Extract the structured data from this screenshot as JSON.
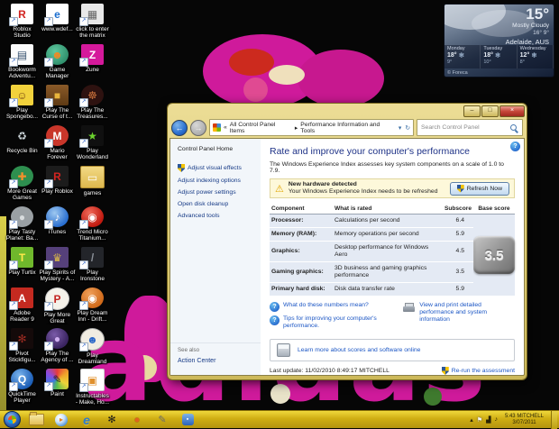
{
  "icons_map": {
    "back": "←",
    "forward": "→",
    "dropdown": "▾",
    "refresh": "↻",
    "shortcut": "↗",
    "warning": "⚠",
    "help": "?",
    "minimize": "–",
    "maximize": "□",
    "close": "×",
    "crumb_sep": "▸",
    "play": "▸",
    "ie": "e",
    "pivot": "✻",
    "game": "●",
    "tool": "✎",
    "msn": "▪",
    "tray_up": "▴",
    "tray_flag": "⚑",
    "tray_net": "▟",
    "tray_vol": "♪",
    "snow": "❄"
  },
  "colors": {
    "accent_gold": "#cfae13",
    "wallpaper_magenta": "#cf1a9b",
    "link_blue": "#1a55c4",
    "heading_blue": "#1e3287"
  },
  "desktop": {
    "wallpaper_word": "adidas",
    "icons": [
      {
        "label": "Roblox Studio",
        "glyph": "R"
      },
      {
        "label": "www.wdef...",
        "glyph": "e"
      },
      {
        "label": "click to enter the matrix",
        "glyph": "▦"
      },
      {
        "label": "Bookworm Adventu...",
        "glyph": "▤"
      },
      {
        "label": "Game Manager",
        "glyph": "☻"
      },
      {
        "label": "Zune",
        "glyph": "Z"
      },
      {
        "label": "Play Spongebo...",
        "glyph": "☺"
      },
      {
        "label": "Play The Curse of t...",
        "glyph": "■"
      },
      {
        "label": "Play The Treasures...",
        "glyph": "☸"
      },
      {
        "label": "Recycle Bin",
        "glyph": "♻"
      },
      {
        "label": "Mario Forever",
        "glyph": "M"
      },
      {
        "label": "Play Wonderland",
        "glyph": "★"
      },
      {
        "label": "More Great Games",
        "glyph": "✚"
      },
      {
        "label": "Play Roblox",
        "glyph": "R"
      },
      {
        "label": "games",
        "glyph": "▭"
      },
      {
        "label": "Play Tasty Planet: Ba...",
        "glyph": "●"
      },
      {
        "label": "iTunes",
        "glyph": "♪"
      },
      {
        "label": "Trend Micro Titanium...",
        "glyph": "◉"
      },
      {
        "label": "Play Turtix",
        "glyph": "T"
      },
      {
        "label": "Play Spirits of Mystery - A...",
        "glyph": "♛"
      },
      {
        "label": "Play Ironstone",
        "glyph": "/"
      },
      {
        "label": "Adobe Reader 9",
        "glyph": "A"
      },
      {
        "label": "Play More Great Games!",
        "glyph": "P"
      },
      {
        "label": "Play Dream Inn - Drift...",
        "glyph": "◉"
      },
      {
        "label": "Pivot Stickfigu...",
        "glyph": "✻"
      },
      {
        "label": "Play The Agency of ...",
        "glyph": "●"
      },
      {
        "label": "Play Dreamland",
        "glyph": "☻"
      },
      {
        "label": "QuickTime Player",
        "glyph": "Q"
      },
      {
        "label": "Paint",
        "glyph": "✎"
      },
      {
        "label": "Instructables - Make, Ho...",
        "glyph": "▣"
      }
    ]
  },
  "weather": {
    "temp": "15°",
    "condition": "Mostly Cloudy",
    "high": "16°",
    "low": "9°",
    "location": "Adelaide, AUS",
    "forecast": [
      {
        "day": "Monday",
        "hi": "18°",
        "lo": "9°"
      },
      {
        "day": "Tuesday",
        "hi": "18°",
        "lo": "10°"
      },
      {
        "day": "Wednesday",
        "hi": "12°",
        "lo": "8°"
      }
    ],
    "credit": "© Foreca"
  },
  "window": {
    "nav": {
      "crumb_prefix": "«",
      "crumb1": "All Control Panel Items",
      "crumb2": "Performance Information and Tools",
      "search_placeholder": "Search Control Panel"
    },
    "sidebar": {
      "home": "Control Panel Home",
      "items": [
        "Adjust visual effects",
        "Adjust indexing options",
        "Adjust power settings",
        "Open disk cleanup",
        "Advanced tools"
      ],
      "see_also": "See also",
      "action_center": "Action Center"
    },
    "main": {
      "title": "Rate and improve your computer's performance",
      "intro": "The Windows Experience Index assesses key system components on a scale of 1.0 to 7.9.",
      "alert_title": "New hardware detected",
      "alert_text": "Your Windows Experience Index needs to be refreshed",
      "refresh_button": "Refresh Now",
      "table": {
        "headers": [
          "Component",
          "What is rated",
          "Subscore",
          "Base score"
        ],
        "rows": [
          {
            "component": "Processor:",
            "rated": "Calculations per second",
            "subscore": "6.4"
          },
          {
            "component": "Memory (RAM):",
            "rated": "Memory operations per second",
            "subscore": "5.9"
          },
          {
            "component": "Graphics:",
            "rated": "Desktop performance for Windows Aero",
            "subscore": "4.5"
          },
          {
            "component": "Gaming graphics:",
            "rated": "3D business and gaming graphics performance",
            "subscore": "3.5"
          },
          {
            "component": "Primary hard disk:",
            "rated": "Disk data transfer rate",
            "subscore": "5.9"
          }
        ],
        "base_score": "3.5"
      },
      "links": {
        "numbers": "What do these numbers mean?",
        "tips": "Tips for improving your computer's performance.",
        "view_print": "View and print detailed performance and system information",
        "learn": "Learn more about scores and software online"
      },
      "last_update": "Last update: 11/02/2010 8:49:17 MITCHELL",
      "rerun": "Re-run the assessment"
    }
  },
  "taskbar": {
    "clock_time": "5:43 MITCHELL",
    "clock_date": "3/07/2011"
  }
}
